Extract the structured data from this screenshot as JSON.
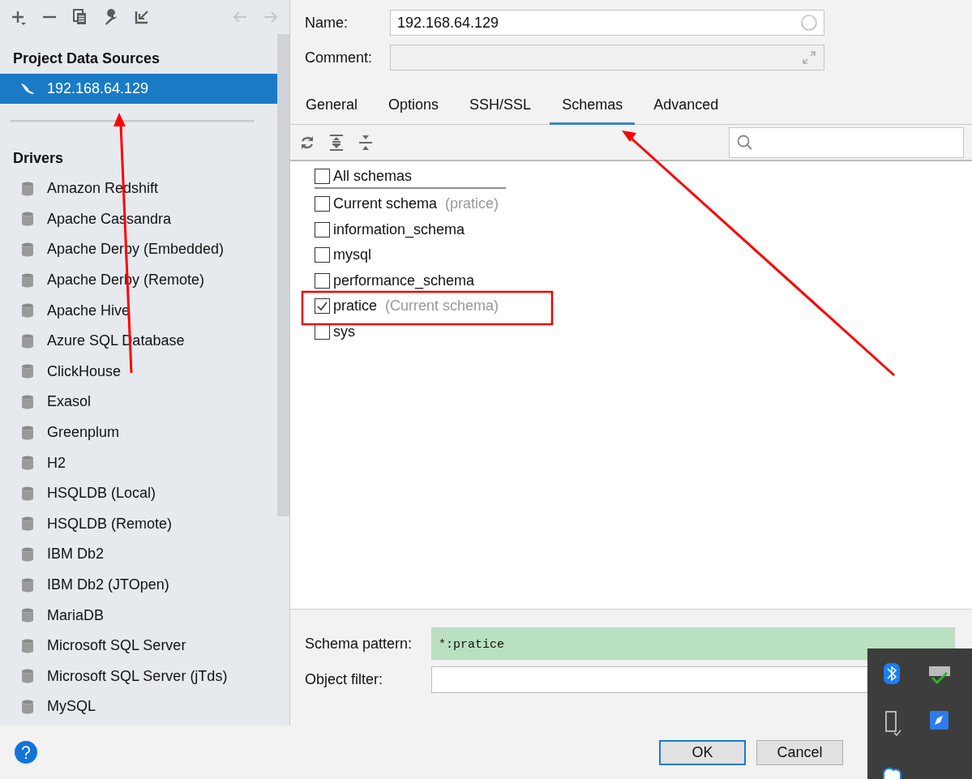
{
  "toolbar": {
    "buttons": [
      {
        "kind": "add",
        "disabled": false
      },
      {
        "kind": "remove",
        "disabled": false
      },
      {
        "kind": "copy",
        "disabled": false
      },
      {
        "kind": "settings",
        "disabled": false
      },
      {
        "kind": "import",
        "disabled": false
      },
      {
        "kind": "back",
        "disabled": true
      },
      {
        "kind": "forward",
        "disabled": true
      }
    ]
  },
  "project_data_sources": {
    "title": "Project Data Sources",
    "items": [
      {
        "label": "192.168.64.129",
        "selected": true
      }
    ]
  },
  "drivers": {
    "title": "Drivers",
    "items": [
      {
        "label": "Amazon Redshift",
        "selected": false
      },
      {
        "label": "Apache Cassandra",
        "selected": false
      },
      {
        "label": "Apache Derby (Embedded)",
        "selected": false
      },
      {
        "label": "Apache Derby (Remote)",
        "selected": false
      },
      {
        "label": "Apache Hive",
        "selected": false
      },
      {
        "label": "Azure SQL Database",
        "selected": false
      },
      {
        "label": "ClickHouse",
        "selected": false
      },
      {
        "label": "Exasol",
        "selected": false
      },
      {
        "label": "Greenplum",
        "selected": false
      },
      {
        "label": "H2",
        "selected": false
      },
      {
        "label": "HSQLDB (Local)",
        "selected": false
      },
      {
        "label": "HSQLDB (Remote)",
        "selected": false
      },
      {
        "label": "IBM Db2",
        "selected": false
      },
      {
        "label": "IBM Db2 (JTOpen)",
        "selected": false
      },
      {
        "label": "MariaDB",
        "selected": false
      },
      {
        "label": "Microsoft SQL Server",
        "selected": false
      },
      {
        "label": "Microsoft SQL Server (jTds)",
        "selected": false
      },
      {
        "label": "MySQL",
        "selected": false
      }
    ]
  },
  "form": {
    "name": {
      "label": "Name:",
      "value": "192.168.64.129"
    },
    "comment": {
      "label": "Comment:"
    }
  },
  "tabs": [
    {
      "label": "General",
      "selected": false
    },
    {
      "label": "Options",
      "selected": false
    },
    {
      "label": "SSH/SSL",
      "selected": false
    },
    {
      "label": "Schemas",
      "selected": true
    },
    {
      "label": "Advanced",
      "selected": false
    }
  ],
  "schemas": [
    {
      "label": "All schemas",
      "checked": false
    },
    {
      "label": "Current schema",
      "note": "(pratice)",
      "checked": false
    },
    {
      "label": "information_schema",
      "checked": false
    },
    {
      "label": "mysql",
      "checked": false
    },
    {
      "label": "performance_schema",
      "checked": false
    },
    {
      "label": "pratice",
      "note": "(Current schema)",
      "checked": true
    },
    {
      "label": "sys",
      "checked": false
    }
  ],
  "schema_pattern": {
    "label": "Schema pattern:",
    "value": "*:pratice"
  },
  "object_filter": {
    "label": "Object filter:"
  },
  "buttons": [
    {
      "label": "OK",
      "default": true
    },
    {
      "label": "Cancel",
      "default": false
    }
  ]
}
